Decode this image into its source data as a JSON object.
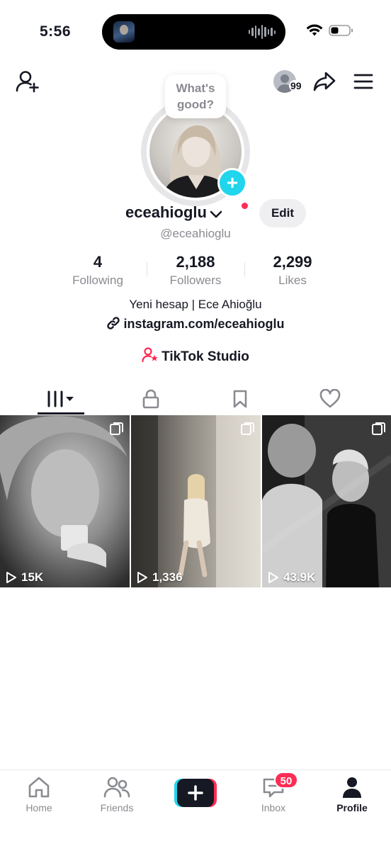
{
  "status": {
    "time": "5:56"
  },
  "header": {
    "friends_badge": "99"
  },
  "profile": {
    "bubble_text": "What's good?",
    "username": "eceahioglu",
    "handle": "@eceahioglu",
    "edit_label": "Edit",
    "stats": [
      {
        "value": "4",
        "label": "Following"
      },
      {
        "value": "2,188",
        "label": "Followers"
      },
      {
        "value": "2,299",
        "label": "Likes"
      }
    ],
    "bio": "Yeni hesap | Ece Ahioğlu",
    "link": "instagram.com/eceahioglu",
    "studio_label": "TikTok Studio"
  },
  "tabs": [
    {
      "name": "videos",
      "icon": "grid-bars-icon",
      "active": true
    },
    {
      "name": "private",
      "icon": "lock-icon"
    },
    {
      "name": "saved",
      "icon": "bookmark-icon"
    },
    {
      "name": "liked",
      "icon": "heart-icon"
    }
  ],
  "videos": [
    {
      "views": "15K"
    },
    {
      "views": "1,336"
    },
    {
      "views": "43.9K"
    }
  ],
  "nav": {
    "items": [
      {
        "label": "Home",
        "icon": "home-icon"
      },
      {
        "label": "Friends",
        "icon": "friends-icon"
      },
      {
        "label": "",
        "icon": "create-plus-icon"
      },
      {
        "label": "Inbox",
        "icon": "inbox-icon"
      },
      {
        "label": "Profile",
        "icon": "profile-icon",
        "active": true
      }
    ],
    "inbox_badge": "50"
  },
  "colors": {
    "accent": "#fe2c55",
    "cyan": "#20d5ec",
    "text": "#161823",
    "muted": "#8a8b91"
  }
}
